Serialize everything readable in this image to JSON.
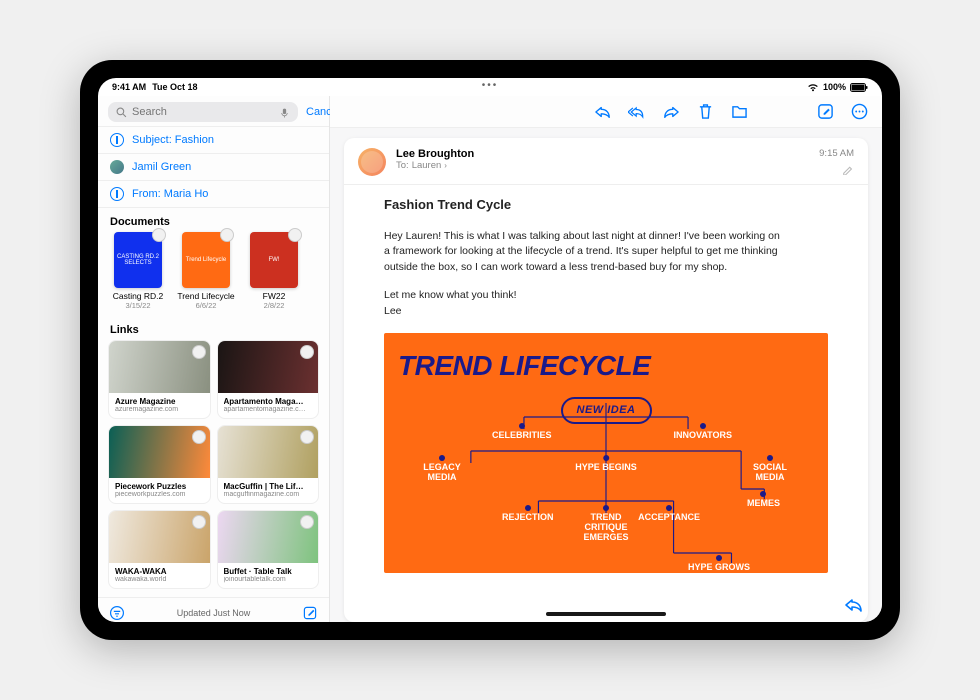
{
  "status": {
    "time": "9:41 AM",
    "date": "Tue Oct 18",
    "battery_pct": "100%"
  },
  "sidebar": {
    "search": {
      "placeholder": "Search",
      "cancel": "Cancel"
    },
    "filters": [
      {
        "label": "Subject: Fashion",
        "type": "subject"
      },
      {
        "label": "Jamil Green",
        "type": "person"
      },
      {
        "label": "From: Maria Ho",
        "type": "from"
      }
    ],
    "sections": {
      "documents_title": "Documents",
      "links_title": "Links"
    },
    "documents": [
      {
        "thumb_label": "CASTING RD.2 SELECTS",
        "color": "#1030ee",
        "label": "Casting RD.2",
        "date": "3/15/22"
      },
      {
        "thumb_label": "Trend Lifecycle",
        "color": "#ff6a13",
        "label": "Trend Lifecycle",
        "date": "6/6/22"
      },
      {
        "thumb_label": "FW!",
        "color": "#cc3020",
        "label": "FW22",
        "date": "2/8/22"
      }
    ],
    "links": [
      {
        "title": "Azure Magazine",
        "url": "azuremagazine.com",
        "color1": "#d0d4cc",
        "color2": "#8a9080"
      },
      {
        "title": "Apartamento Maga…",
        "url": "apartamentomagazine.c…",
        "color1": "#1a1514",
        "color2": "#6b3030"
      },
      {
        "title": "Piecework Puzzles",
        "url": "pieceworkpuzzles.com",
        "color1": "#0a5f55",
        "color2": "#ff8a3a"
      },
      {
        "title": "MacGuffin | The Lif…",
        "url": "macguffinmagazine.com",
        "color1": "#e6e1d4",
        "color2": "#b0a060"
      },
      {
        "title": "WAKA-WAKA",
        "url": "wakawaka.world",
        "color1": "#efe9df",
        "color2": "#caa46a"
      },
      {
        "title": "Buffet · Table Talk",
        "url": "joinourtabletalk.com",
        "color1": "#ecd7f1",
        "color2": "#7ec37e"
      }
    ],
    "footer_status": "Updated Just Now"
  },
  "message": {
    "from": "Lee Broughton",
    "to_label": "To:",
    "to_name": "Lauren",
    "time": "9:15 AM",
    "subject": "Fashion Trend Cycle",
    "body1": "Hey Lauren! This is what I was talking about last night at dinner! I've been working on a framework for looking at the lifecycle of a trend. It's super helpful to get me thinking outside the box, so I can work toward a less trend-based buy for my shop.",
    "body2": "Let me know what you think!",
    "sig": "Lee"
  },
  "infographic": {
    "title": "TREND LIFECYCLE",
    "new_idea": "NEW IDEA",
    "nodes": {
      "celebrities": "CELEBRITIES",
      "innovators": "INNOVATORS",
      "legacy": "LEGACY MEDIA",
      "hype_begins": "HYPE BEGINS",
      "social": "SOCIAL MEDIA",
      "memes": "MEMES",
      "rejection": "REJECTION",
      "critique": "TREND CRITIQUE EMERGES",
      "acceptance": "ACCEPTANCE",
      "hype_grows": "HYPE GROWS"
    }
  }
}
